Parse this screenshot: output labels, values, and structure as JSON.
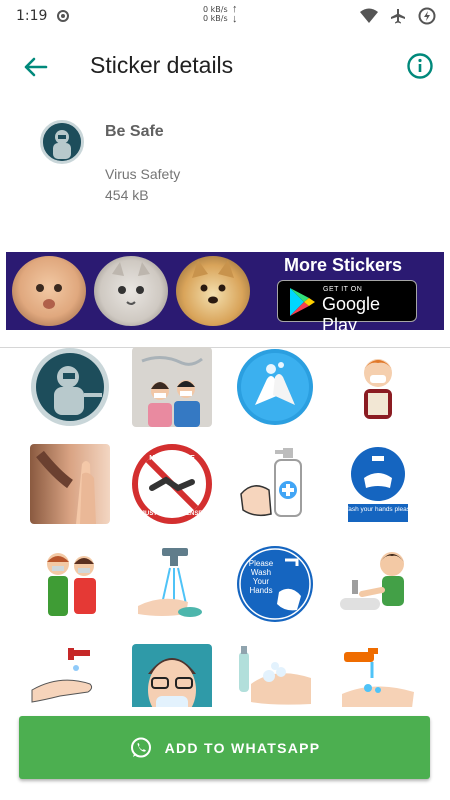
{
  "status_bar": {
    "time": "1:19",
    "net_up": "0 kB/s",
    "net_down": "0 kB/s"
  },
  "app_bar": {
    "title": "Sticker details",
    "back_icon": "arrow-back-icon",
    "info_icon": "info-icon",
    "accent_color": "#00897b"
  },
  "pack": {
    "name": "Be Safe",
    "publisher": "Virus Safety",
    "size": "454 kB"
  },
  "banner": {
    "title": "More Stickers",
    "badge_small": "GET IT ON",
    "badge_big": "Google Play",
    "background": "#2b1a72"
  },
  "stickers": [
    {
      "name": "sticker-hazmat-worker"
    },
    {
      "name": "sticker-masked-couple"
    },
    {
      "name": "sticker-soap-hands"
    },
    {
      "name": "sticker-masked-boy"
    },
    {
      "name": "sticker-praying-hands"
    },
    {
      "name": "sticker-no-handshake"
    },
    {
      "name": "sticker-sanitizer-bottle"
    },
    {
      "name": "sticker-wash-your-hands-sign"
    },
    {
      "name": "sticker-masked-kids"
    },
    {
      "name": "sticker-tap-water-hands"
    },
    {
      "name": "sticker-please-wash-your-hands"
    },
    {
      "name": "sticker-boy-washing-hands"
    },
    {
      "name": "sticker-soap-dispenser"
    },
    {
      "name": "sticker-masked-man"
    },
    {
      "name": "sticker-foam-hands"
    },
    {
      "name": "sticker-faucet-hands"
    }
  ],
  "sticker_texts": {
    "no_offense_top": "NO OFFENSE",
    "no_offense_bottom": "JUST MAKES SENSE",
    "wash_sign": "Wash your hands please",
    "please_wash_1": "Please",
    "please_wash_2": "Wash",
    "please_wash_3": "Your",
    "please_wash_4": "Hands"
  },
  "cta": {
    "label": "ADD TO WHATSAPP",
    "icon": "whatsapp-icon",
    "color": "#4caf50"
  }
}
